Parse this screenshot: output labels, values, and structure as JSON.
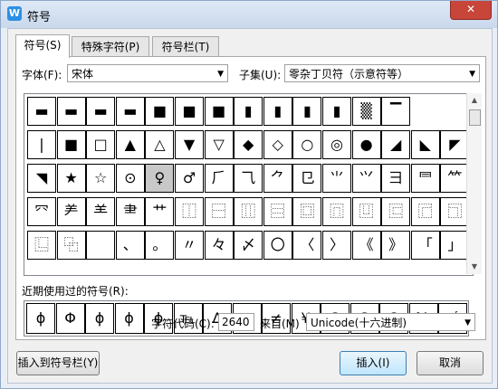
{
  "window": {
    "title": "符号",
    "app_icon_letter": "W",
    "close_symbol": "✕"
  },
  "tabs": [
    {
      "label": "符号(S)",
      "active": true
    },
    {
      "label": "特殊字符(P)",
      "active": false
    },
    {
      "label": "符号栏(T)",
      "active": false
    }
  ],
  "font": {
    "label": "字体(F):",
    "value": "宋体"
  },
  "subset": {
    "label": "子集(U):",
    "value": "零杂丁贝符（示意符等）"
  },
  "symbols": [
    [
      "▬",
      "▬",
      "▬",
      "▬",
      "■",
      "■",
      "■",
      "▮",
      "▮",
      "▮",
      "▮",
      "▒",
      "▔"
    ],
    [
      "❘",
      "■",
      "□",
      "▲",
      "△",
      "▼",
      "▽",
      "◆",
      "◇",
      "○",
      "◎",
      "●",
      "◢",
      "◣",
      "◤"
    ],
    [
      "◥",
      "★",
      "☆",
      "⊙",
      "♀",
      "♂",
      "⺁",
      "⺄",
      "⺈",
      "⺋",
      "⺌",
      "⺍",
      "⺕",
      "⺜",
      "⺮"
    ],
    [
      "⺳",
      "⺶",
      "⺷",
      "⺻",
      "⺾",
      "⿰",
      "⿱",
      "⿲",
      "⿳",
      "⿴",
      "⿵",
      "⿶",
      "⿷",
      "⿸",
      "⿹"
    ],
    [
      "⿺",
      "⿻",
      "",
      "、",
      "。",
      "〃",
      "々",
      "〆",
      "〇",
      "〈",
      "〉",
      "《",
      "》",
      "「",
      "」"
    ]
  ],
  "selected_symbol_index": {
    "row": 2,
    "col": 4
  },
  "recent": {
    "label": "近期使用过的符号(R):",
    "items": [
      "ɸ",
      "Φ",
      "ɸ",
      "ɸ",
      "ϕ",
      "℡",
      "∆",
      "㎜",
      "≠",
      "¥",
      "①",
      "②",
      "③",
      "№",
      "√"
    ]
  },
  "char_code": {
    "label": "字符代码(C):",
    "value": "2640"
  },
  "from": {
    "label": "来自(M)",
    "value": "Unicode(十六进制)"
  },
  "buttons": {
    "insert_to_bar": "插入到符号栏(Y)",
    "insert": "插入(I)",
    "cancel": "取消"
  }
}
